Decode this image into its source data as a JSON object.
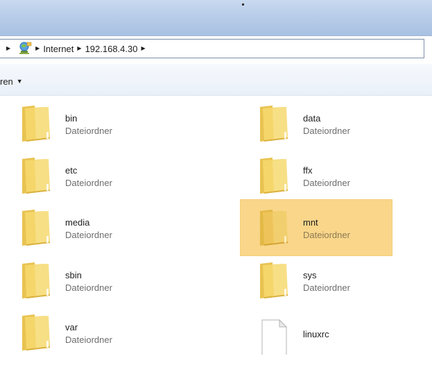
{
  "address": {
    "crumbs": [
      "Internet",
      "192.168.4.30"
    ],
    "icon": "network-globe-icon"
  },
  "toolbar": {
    "organize_label": "ren"
  },
  "items": [
    {
      "name": "bin",
      "type": "Dateiordner",
      "icon": "folder-icon"
    },
    {
      "name": "data",
      "type": "Dateiordner",
      "icon": "folder-icon"
    },
    {
      "name": "etc",
      "type": "Dateiordner",
      "icon": "folder-icon"
    },
    {
      "name": "ffx",
      "type": "Dateiordner",
      "icon": "folder-icon"
    },
    {
      "name": "media",
      "type": "Dateiordner",
      "icon": "folder-icon"
    },
    {
      "name": "mnt",
      "type": "Dateiordner",
      "icon": "folder-icon",
      "selected": true
    },
    {
      "name": "sbin",
      "type": "Dateiordner",
      "icon": "folder-icon"
    },
    {
      "name": "sys",
      "type": "Dateiordner",
      "icon": "folder-icon"
    },
    {
      "name": "var",
      "type": "Dateiordner",
      "icon": "folder-icon"
    },
    {
      "name": "linuxrc",
      "icon": "file-icon"
    }
  ],
  "colors": {
    "selection": "#f9d68a",
    "folder": "#f5d66b",
    "titlebar": "#b8cde9"
  }
}
